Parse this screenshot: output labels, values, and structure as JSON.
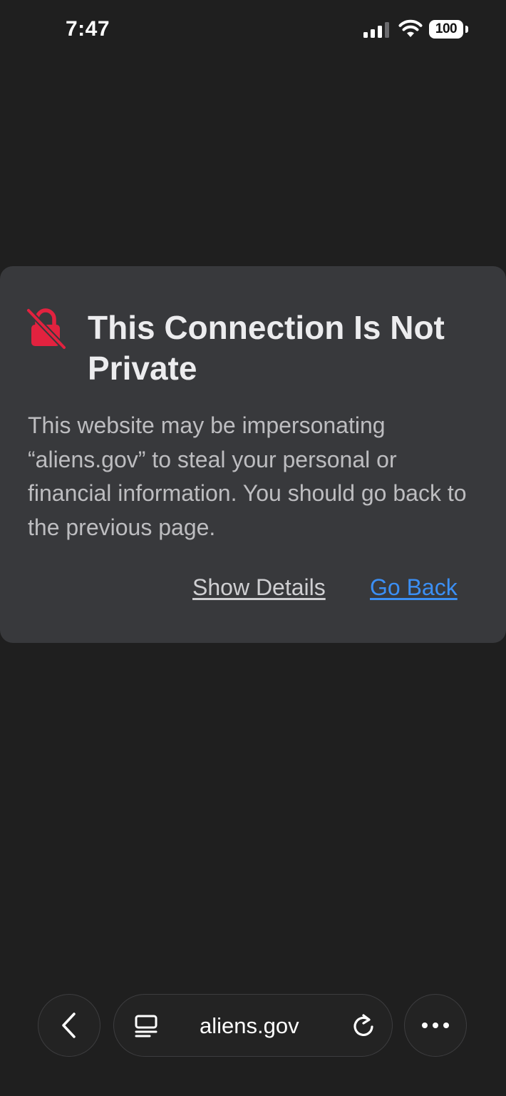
{
  "status_bar": {
    "time": "7:47",
    "battery_level": "100",
    "icons": [
      "cellular-signal-icon",
      "wifi-icon",
      "battery-icon"
    ]
  },
  "warning": {
    "icon": "lock-slash-icon",
    "icon_color": "#e2223f",
    "title": "This Connection Is Not Private",
    "body": "This website may be impersonating “aliens.gov” to steal your personal or financial information. You should go back to the previous page.",
    "show_details_label": "Show Details",
    "go_back_label": "Go Back",
    "link_color": "#3b8ff5"
  },
  "toolbar": {
    "back_icon": "chevron-left-icon",
    "reader_icon": "reader-mode-icon",
    "url": "aliens.gov",
    "reload_icon": "reload-icon",
    "more_icon": "ellipsis-icon"
  }
}
